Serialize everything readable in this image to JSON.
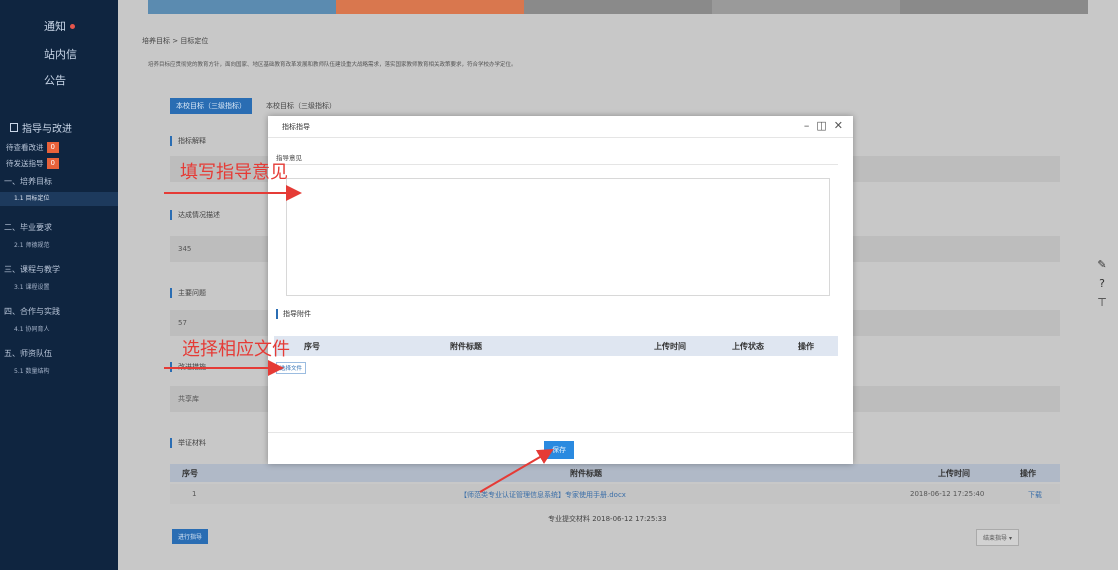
{
  "sidebar": {
    "top": [
      "通知",
      "站内信",
      "公告"
    ],
    "section": "指导与改进",
    "pending_review": {
      "label": "待查看改进",
      "count": "0"
    },
    "pending_send": {
      "label": "待发送指导",
      "count": "0"
    },
    "tree": [
      {
        "group": "一、培养目标",
        "leaf": "1.1 目标定位",
        "active": true
      },
      {
        "group": "二、毕业要求",
        "leaf": "2.1 师德规范"
      },
      {
        "group": "三、课程与教学",
        "leaf": "3.1 课程设置"
      },
      {
        "group": "四、合作与实践",
        "leaf": "4.1 协同育人"
      },
      {
        "group": "五、师资队伍",
        "leaf": "5.1 数量结构"
      }
    ]
  },
  "main": {
    "breadcrumb": "培养目标 > 目标定位",
    "description": "培养目标应贯彻党的教育方针，面向国家、地区基础教育改革发展和教师队伍建设重大战略需求，落实国家教师教育相关政策要求，符合学校办学定位。",
    "tabs": [
      "本校目标（三级指标）",
      "本校目标（三级指标）"
    ],
    "sections": {
      "explain": "指标解释",
      "achieve": "达成情况描述",
      "achieve_value": "345",
      "problem": "主要问题",
      "problem_value": "57",
      "improve": "改进措施",
      "improve_value": "共享库",
      "evidence": "举证材料"
    },
    "table": {
      "headers": [
        "序号",
        "附件标题",
        "上传时间",
        "操作"
      ],
      "rows": [
        {
          "no": "1",
          "title": "【师范类专业认证管理信息系统】专家使用手册.docx",
          "time": "2018-06-12 17:25:40",
          "action": "下载"
        }
      ]
    },
    "submitted": "专业提交材料 2018-06-12 17:25:33",
    "guide_button": "进行指导",
    "result_select": "结束指导"
  },
  "modal": {
    "title": "指标指导",
    "opinion_label": "指导意见",
    "attach_label": "指导附件",
    "attach_headers": [
      "序号",
      "附件标题",
      "上传时间",
      "上传状态",
      "操作"
    ],
    "choose_file": "选择文件",
    "save": "保存"
  },
  "annotations": {
    "fill_opinion": "填写指导意见",
    "choose_file": "选择相应文件"
  },
  "colors": {
    "sidebar_bg": "#0f2540",
    "accent": "#2a6db3",
    "annotation": "#e53b36",
    "badge": "#e8623a"
  }
}
